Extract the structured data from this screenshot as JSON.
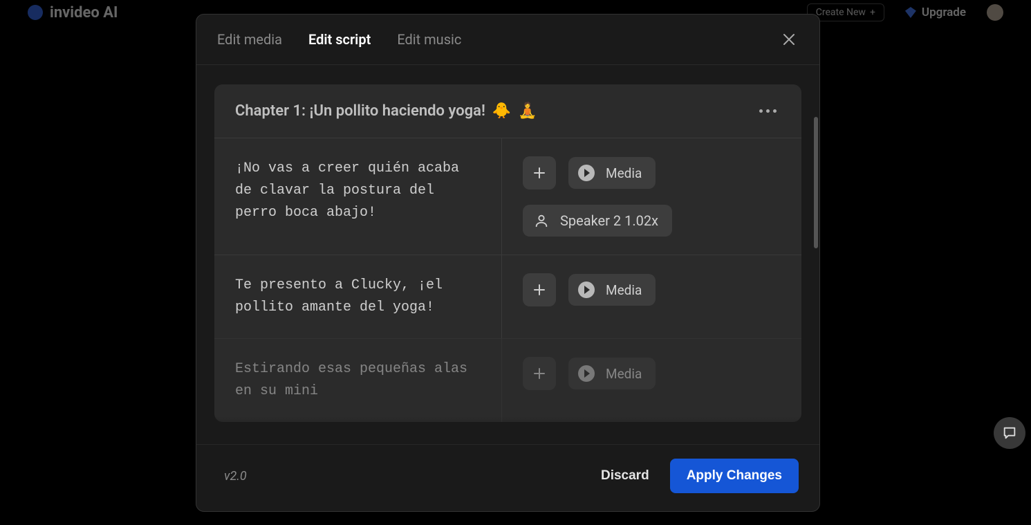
{
  "topbar": {
    "brand": "invideo AI",
    "create_new": "Create New",
    "upgrade": "Upgrade"
  },
  "modal": {
    "tabs": {
      "media": "Edit media",
      "script": "Edit script",
      "music": "Edit music"
    },
    "chapter_title": "Chapter 1: ¡Un pollito haciendo yoga!",
    "emoji1": "🐥",
    "emoji2": "🧘",
    "rows": [
      {
        "text": "¡No vas a creer quién acaba de clavar la postura del perro boca abajo!",
        "media": "Media",
        "speaker": "Speaker 2 1.02x"
      },
      {
        "text": "Te presento a Clucky, ¡el pollito amante del yoga!",
        "media": "Media"
      },
      {
        "text": "Estirando esas pequeñas alas en su mini",
        "media": "Media"
      }
    ],
    "version": "v2.0",
    "discard": "Discard",
    "apply": "Apply Changes"
  }
}
